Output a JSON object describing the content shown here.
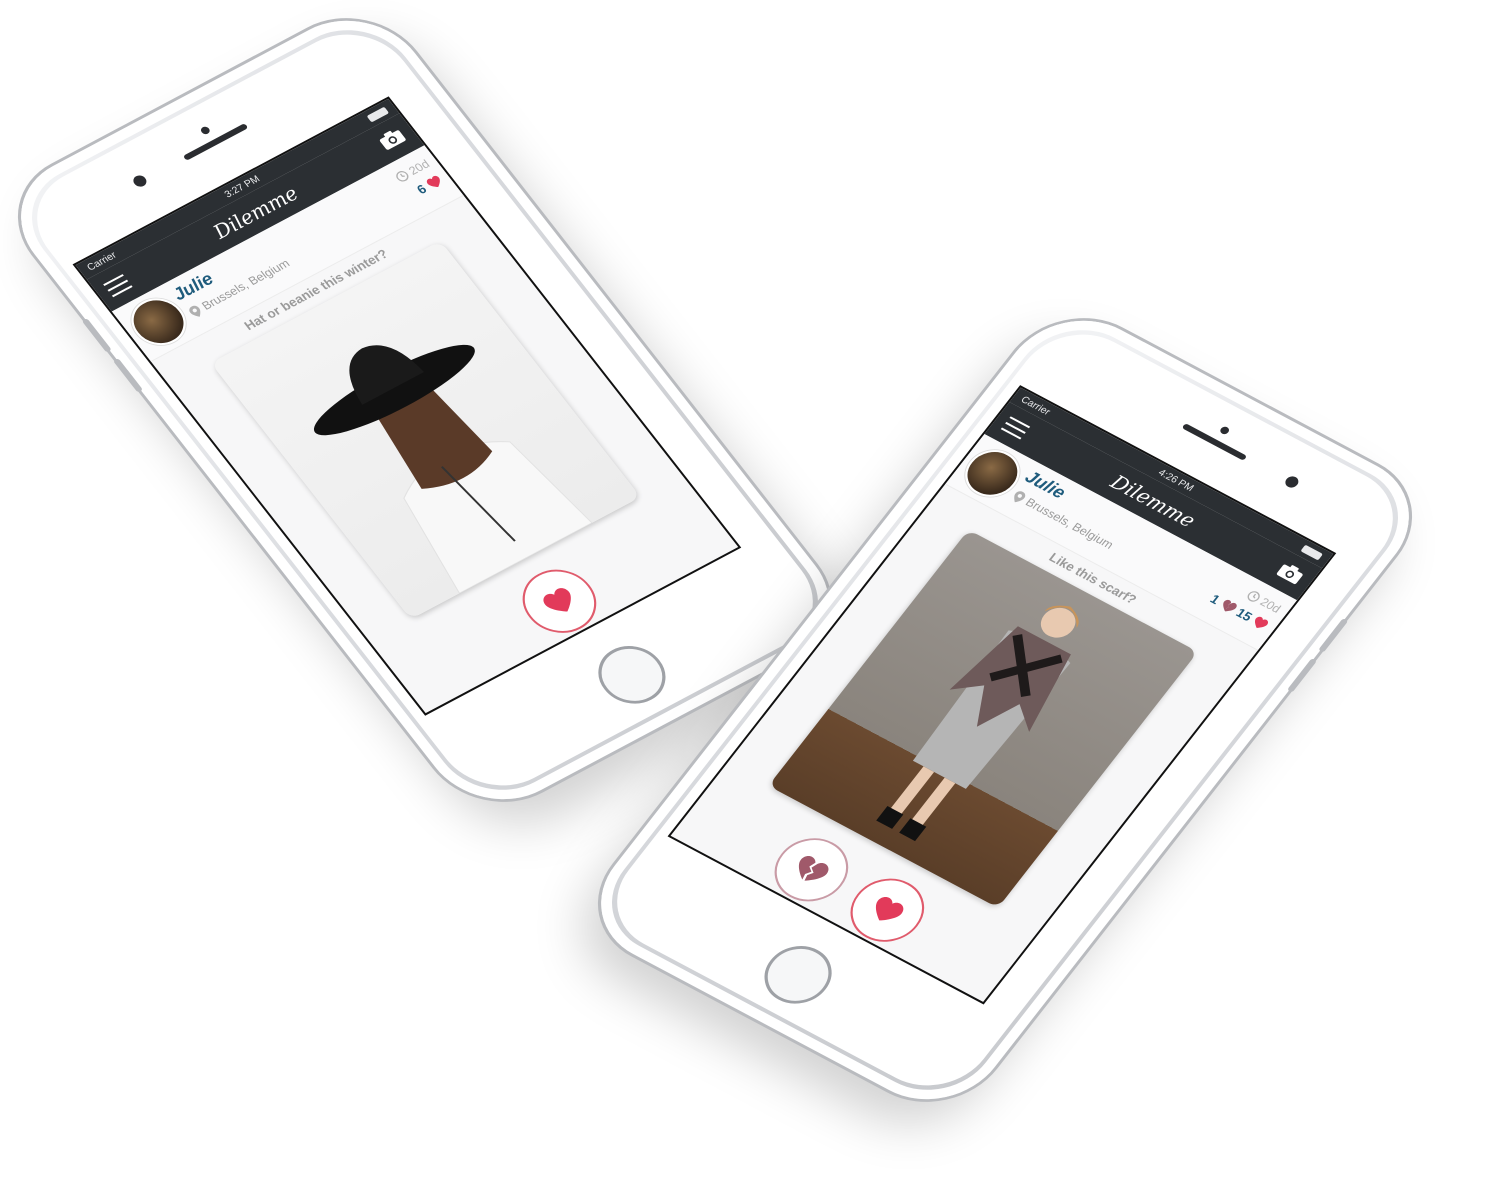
{
  "phones": [
    {
      "status": {
        "carrier": "Carrier",
        "time": "3:27 PM"
      },
      "app_name": "Dilemme",
      "post": {
        "user": "Julie",
        "location": "Brussels, Belgium",
        "age": "20d",
        "likes": "6",
        "question": "Hat or beanie this winter?"
      },
      "icons": {
        "menu": "menu-icon",
        "camera": "camera-icon",
        "like": "heart-icon"
      }
    },
    {
      "status": {
        "carrier": "Carrier",
        "time": "4:26 PM"
      },
      "app_name": "Dilemme",
      "post": {
        "user": "Julie",
        "location": "Brussels, Belgium",
        "age": "20d",
        "dislikes": "1",
        "likes": "15",
        "question": "Like this scarf?"
      },
      "icons": {
        "menu": "menu-icon",
        "camera": "camera-icon",
        "like": "heart-icon",
        "dislike": "broken-heart-icon"
      }
    }
  ],
  "colors": {
    "navbar": "#2b2f33",
    "accent": "#e23a5a",
    "name": "#1f5c7d"
  }
}
